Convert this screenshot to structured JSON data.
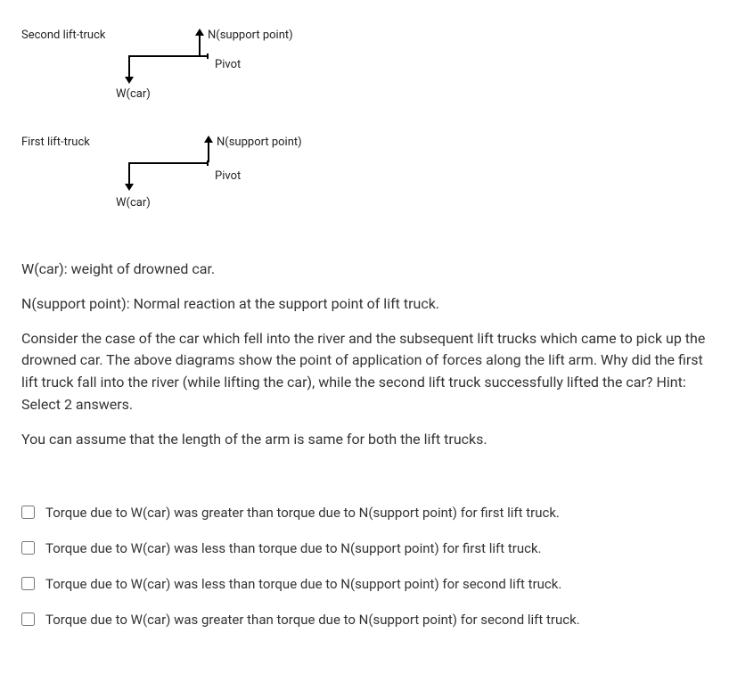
{
  "diagrams": {
    "second": {
      "title": "Second lift-truck",
      "n_label": "N(support point)",
      "pivot": "Pivot",
      "w_label": "W(car)"
    },
    "first": {
      "title": "First lift-truck",
      "n_label": "N(support point)",
      "pivot": "Pivot",
      "w_label": "W(car)"
    }
  },
  "definitions": {
    "wcar": "W(car): weight of drowned car.",
    "nsupport": "N(support point): Normal reaction at the support point of lift truck."
  },
  "question": {
    "body": "Consider the case of the car which fell into the river and the subsequent lift trucks which came to pick up the drowned car. The above diagrams show the point of application of forces along the lift arm. Why did the first lift truck fall into the river (while lifting the car), while the second lift truck successfully lifted the car? Hint: Select 2 answers.",
    "assumption": "You can assume that the length of the arm is same for both the lift trucks."
  },
  "options": [
    "Torque due to W(car) was greater than torque due to N(support point) for first lift truck.",
    "Torque due to W(car) was less than torque due to N(support point) for first lift truck.",
    "Torque due to W(car) was less than torque due to N(support point) for second lift truck.",
    "Torque due to W(car) was greater than torque due to N(support point) for second lift truck."
  ]
}
